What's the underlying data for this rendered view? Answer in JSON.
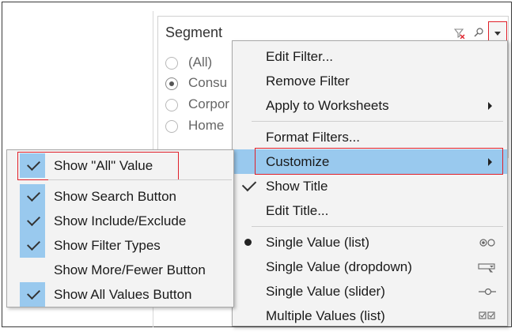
{
  "filter": {
    "title": "Segment",
    "options": [
      {
        "label": "(All)",
        "selected": false
      },
      {
        "label": "Consu",
        "selected": true
      },
      {
        "label": "Corpor",
        "selected": false
      },
      {
        "label": "Home",
        "selected": false
      }
    ]
  },
  "menu": {
    "items": [
      {
        "label": "Edit Filter..."
      },
      {
        "label": "Remove Filter"
      },
      {
        "label": "Apply to Worksheets",
        "submenu": true
      },
      {
        "label": "Format Filters..."
      },
      {
        "label": "Customize",
        "submenu": true,
        "highlighted": true
      },
      {
        "label": "Show Title",
        "checked": true
      },
      {
        "label": "Edit Title..."
      },
      {
        "label": "Single Value (list)",
        "bullet": true,
        "icon": "radio-list-icon"
      },
      {
        "label": "Single Value (dropdown)",
        "icon": "dropdown-list-icon"
      },
      {
        "label": "Single Value (slider)",
        "icon": "slider-icon"
      },
      {
        "label": "Multiple Values (list)",
        "icon": "checkbox-list-icon"
      }
    ]
  },
  "submenu": {
    "items": [
      {
        "label": "Show \"All\" Value",
        "checked": true,
        "highlighted": true
      },
      {
        "label": "Show Search Button",
        "checked": true
      },
      {
        "label": "Show Include/Exclude",
        "checked": true
      },
      {
        "label": "Show Filter Types",
        "checked": true
      },
      {
        "label": "Show More/Fewer Button",
        "checked": false
      },
      {
        "label": "Show All Values Button",
        "checked": true
      }
    ]
  },
  "colors": {
    "highlight": "#99c9ee",
    "callout_border": "#e0202a",
    "menu_bg": "#f3f3f3"
  }
}
